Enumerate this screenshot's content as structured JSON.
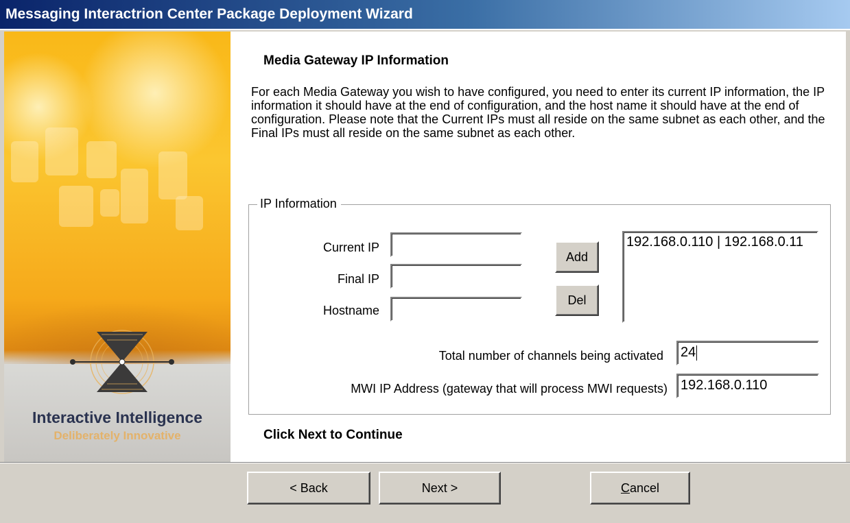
{
  "window": {
    "title": "Messaging Interactrion Center Package Deployment Wizard"
  },
  "branding": {
    "company": "Interactive Intelligence",
    "tagline": "Deliberately Innovative",
    "colors": {
      "primary_orange": "#f9b818",
      "navy": "#2a3350",
      "tagline": "#e3b26a"
    }
  },
  "page": {
    "heading": "Media Gateway IP Information",
    "description": "For each Media Gateway you wish to have configured, you need to enter its current IP information, the IP information it should have at the end of configuration, and the host name it should have at the end of configuration.  Please note that the Current IPs must all reside on the same subnet as each other, and the Final IPs must all reside on the same subnet as each other.",
    "hint": "Click Next to Continue"
  },
  "ip_group": {
    "legend": "IP Information",
    "current_ip": {
      "label": "Current IP",
      "value": ""
    },
    "final_ip": {
      "label": "Final IP",
      "value": ""
    },
    "hostname": {
      "label": "Hostname",
      "value": ""
    },
    "add_label": "Add",
    "del_label": "Del",
    "gateways": [
      "192.168.0.110 | 192.168.0.11"
    ],
    "channels": {
      "label": "Total number of channels being activated",
      "value": "24"
    },
    "mwi": {
      "label": "MWI IP Address (gateway that will process MWI requests)",
      "value": "192.168.0.110"
    }
  },
  "buttons": {
    "back": "< Back",
    "next": "Next >",
    "cancel_first": "C",
    "cancel_rest": "ancel"
  }
}
